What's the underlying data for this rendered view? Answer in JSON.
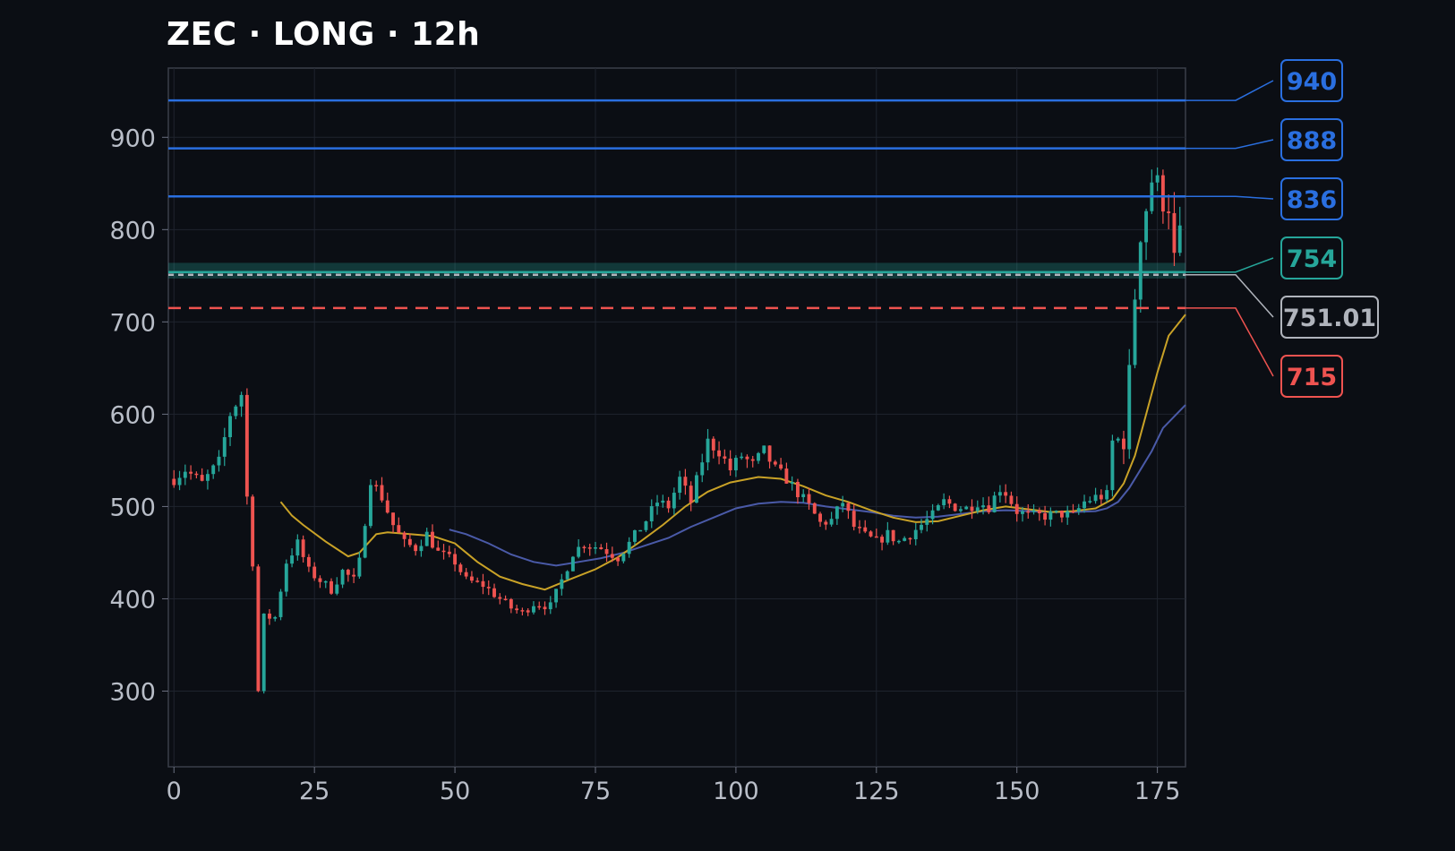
{
  "chart_data": {
    "type": "candlestick",
    "title": "ZEC · LONG · 12h",
    "xlabel": "",
    "ylabel": "",
    "xlim": [
      -1,
      180
    ],
    "ylim": [
      218,
      975
    ],
    "xticks": [
      0,
      25,
      50,
      75,
      100,
      125,
      150,
      175
    ],
    "yticks": [
      300,
      400,
      500,
      600,
      700,
      800,
      900
    ],
    "grid": true,
    "colors": {
      "background": "#0b0e14",
      "grid": "#1f242e",
      "up": "#26a69a",
      "down": "#ef5350",
      "target": "#2a6fe0",
      "entry": "#26a69a",
      "current": "#b0b4bc",
      "stop": "#ef5350",
      "ma_fast": "#c9a227",
      "ma_slow": "#4a5aa8",
      "tick_text": "#b9bec8"
    },
    "levels": [
      {
        "kind": "target",
        "label": "940",
        "value": 940
      },
      {
        "kind": "target",
        "label": "888",
        "value": 888
      },
      {
        "kind": "target",
        "label": "836",
        "value": 836
      },
      {
        "kind": "entry",
        "label": "754",
        "value": 754
      },
      {
        "kind": "current",
        "label": "751.01",
        "value": 751.01
      },
      {
        "kind": "stop",
        "label": "715",
        "value": 715
      }
    ],
    "entry_zone": [
      747,
      764
    ],
    "ohlc_anchors": [
      [
        0,
        530
      ],
      [
        2,
        540
      ],
      [
        5,
        525
      ],
      [
        8,
        548
      ],
      [
        10,
        600
      ],
      [
        12,
        622
      ],
      [
        13,
        510
      ],
      [
        14,
        440
      ],
      [
        15,
        300
      ],
      [
        16,
        380
      ],
      [
        18,
        380
      ],
      [
        20,
        440
      ],
      [
        22,
        460
      ],
      [
        24,
        430
      ],
      [
        26,
        420
      ],
      [
        28,
        410
      ],
      [
        30,
        430
      ],
      [
        32,
        420
      ],
      [
        33,
        440
      ],
      [
        35,
        530
      ],
      [
        37,
        510
      ],
      [
        39,
        480
      ],
      [
        41,
        460
      ],
      [
        43,
        455
      ],
      [
        45,
        470
      ],
      [
        47,
        450
      ],
      [
        50,
        440
      ],
      [
        52,
        420
      ],
      [
        55,
        415
      ],
      [
        57,
        405
      ],
      [
        60,
        390
      ],
      [
        62,
        385
      ],
      [
        64,
        395
      ],
      [
        67,
        392
      ],
      [
        69,
        420
      ],
      [
        71,
        450
      ],
      [
        73,
        460
      ],
      [
        76,
        455
      ],
      [
        79,
        445
      ],
      [
        81,
        460
      ],
      [
        84,
        485
      ],
      [
        86,
        505
      ],
      [
        88,
        500
      ],
      [
        90,
        530
      ],
      [
        92,
        505
      ],
      [
        94,
        550
      ],
      [
        95,
        570
      ],
      [
        97,
        560
      ],
      [
        99,
        540
      ],
      [
        101,
        555
      ],
      [
        103,
        545
      ],
      [
        105,
        560
      ],
      [
        107,
        540
      ],
      [
        109,
        530
      ],
      [
        111,
        515
      ],
      [
        113,
        500
      ],
      [
        115,
        482
      ],
      [
        117,
        485
      ],
      [
        119,
        505
      ],
      [
        121,
        478
      ],
      [
        123,
        468
      ],
      [
        125,
        462
      ],
      [
        127,
        470
      ],
      [
        129,
        462
      ],
      [
        131,
        470
      ],
      [
        133,
        480
      ],
      [
        135,
        490
      ],
      [
        137,
        505
      ],
      [
        139,
        500
      ],
      [
        141,
        498
      ],
      [
        143,
        505
      ],
      [
        145,
        500
      ],
      [
        147,
        520
      ],
      [
        148,
        515
      ],
      [
        150,
        495
      ],
      [
        152,
        490
      ],
      [
        155,
        490
      ],
      [
        158,
        492
      ],
      [
        160,
        490
      ],
      [
        162,
        505
      ],
      [
        164,
        510
      ],
      [
        166,
        512
      ],
      [
        167,
        570
      ],
      [
        169,
        575
      ],
      [
        170,
        640
      ],
      [
        171,
        730
      ],
      [
        172,
        800
      ],
      [
        173,
        825
      ],
      [
        174,
        855
      ],
      [
        175,
        845
      ],
      [
        176,
        835
      ],
      [
        177,
        830
      ],
      [
        178,
        765
      ],
      [
        179,
        790
      ]
    ],
    "ma_fast": [
      [
        19,
        505
      ],
      [
        21,
        490
      ],
      [
        23,
        480
      ],
      [
        27,
        462
      ],
      [
        31,
        446
      ],
      [
        33,
        450
      ],
      [
        36,
        470
      ],
      [
        38,
        472
      ],
      [
        42,
        470
      ],
      [
        46,
        468
      ],
      [
        50,
        460
      ],
      [
        54,
        440
      ],
      [
        58,
        424
      ],
      [
        62,
        416
      ],
      [
        66,
        410
      ],
      [
        70,
        420
      ],
      [
        75,
        432
      ],
      [
        79,
        445
      ],
      [
        83,
        462
      ],
      [
        87,
        480
      ],
      [
        91,
        500
      ],
      [
        95,
        516
      ],
      [
        99,
        526
      ],
      [
        104,
        532
      ],
      [
        108,
        530
      ],
      [
        112,
        522
      ],
      [
        116,
        512
      ],
      [
        120,
        505
      ],
      [
        124,
        496
      ],
      [
        128,
        488
      ],
      [
        132,
        483
      ],
      [
        136,
        484
      ],
      [
        140,
        490
      ],
      [
        144,
        496
      ],
      [
        148,
        500
      ],
      [
        152,
        497
      ],
      [
        156,
        494
      ],
      [
        160,
        495
      ],
      [
        164,
        498
      ],
      [
        167,
        508
      ],
      [
        169,
        525
      ],
      [
        171,
        555
      ],
      [
        173,
        600
      ],
      [
        175,
        645
      ],
      [
        177,
        685
      ],
      [
        180,
        708
      ]
    ],
    "ma_slow": [
      [
        49,
        475
      ],
      [
        52,
        470
      ],
      [
        56,
        460
      ],
      [
        60,
        448
      ],
      [
        64,
        440
      ],
      [
        68,
        436
      ],
      [
        72,
        440
      ],
      [
        76,
        444
      ],
      [
        80,
        450
      ],
      [
        84,
        458
      ],
      [
        88,
        466
      ],
      [
        92,
        478
      ],
      [
        96,
        488
      ],
      [
        100,
        498
      ],
      [
        104,
        503
      ],
      [
        108,
        505
      ],
      [
        112,
        504
      ],
      [
        116,
        500
      ],
      [
        120,
        497
      ],
      [
        124,
        494
      ],
      [
        128,
        490
      ],
      [
        132,
        488
      ],
      [
        136,
        489
      ],
      [
        140,
        492
      ],
      [
        144,
        495
      ],
      [
        148,
        496
      ],
      [
        152,
        495
      ],
      [
        156,
        494
      ],
      [
        160,
        494
      ],
      [
        164,
        495
      ],
      [
        166,
        498
      ],
      [
        168,
        505
      ],
      [
        170,
        520
      ],
      [
        172,
        540
      ],
      [
        174,
        560
      ],
      [
        176,
        585
      ],
      [
        180,
        610
      ]
    ]
  }
}
